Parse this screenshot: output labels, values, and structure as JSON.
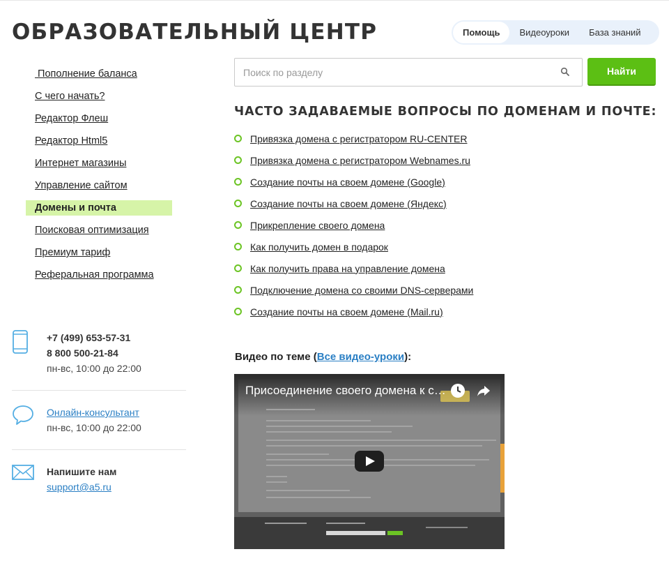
{
  "header": {
    "title": "ОБРАЗОВАТЕЛЬНЫЙ ЦЕНТР",
    "tabs": [
      {
        "label": "Помощь",
        "active": true
      },
      {
        "label": "Видеоуроки",
        "active": false
      },
      {
        "label": "База знаний",
        "active": false
      }
    ]
  },
  "sidebar": {
    "items": [
      {
        "label": " Пополнение баланса",
        "active": false
      },
      {
        "label": "С чего начать?",
        "active": false
      },
      {
        "label": "Редактор Флеш",
        "active": false
      },
      {
        "label": "Редактор Html5",
        "active": false
      },
      {
        "label": "Интернет магазины",
        "active": false
      },
      {
        "label": "Управление сайтом",
        "active": false
      },
      {
        "label": "Домены и почта",
        "active": true
      },
      {
        "label": "Поисковая оптимизация",
        "active": false
      },
      {
        "label": "Премиум тариф",
        "active": false
      },
      {
        "label": "Реферальная программа",
        "active": false
      }
    ],
    "contacts": {
      "phone1": "+7 (499) 653-57-31",
      "phone2": "8 800 500-21-84",
      "hours": "пн-вс, 10:00 до 22:00",
      "consultant_label": "Онлайн-консультант",
      "consultant_hours": "пн-вс, 10:00 до 22:00",
      "write_label": "Напишите нам",
      "email": "support@a5.ru"
    }
  },
  "search": {
    "placeholder": "Поиск по разделу",
    "value": "",
    "button_label": "Найти"
  },
  "faq": {
    "heading": "ЧАСТО ЗАДАВАЕМЫЕ ВОПРОСЫ ПО ДОМЕНАМ И ПОЧТЕ:",
    "items": [
      "Привязка домена с регистратором RU-CENTER",
      "Привязка домена с регистратором Webnames.ru",
      "Создание почты на своем домене (Google)",
      "Создание почты на своем домене (Яндекс)",
      "Прикрепление своего домена",
      "Как получить домен в подарок",
      "Как получить права на управление домена",
      "Подключение домена со своими DNS-серверами",
      "Создание почты на своем домене (Mail.ru)"
    ]
  },
  "video": {
    "label_prefix": "Видео по теме (",
    "label_link": "Все видео-уроки",
    "label_suffix": "):",
    "title": "Присоединение своего домена к сайту"
  },
  "colors": {
    "accent_green": "#5cbf14",
    "active_nav_bg": "#d6f4a8",
    "link_blue": "#2a7fc4",
    "icon_blue": "#54aee3"
  },
  "icons": {
    "search": "search-icon",
    "phone": "phone-icon",
    "chat": "chat-bubble-icon",
    "mail": "envelope-icon",
    "play": "play-icon"
  }
}
